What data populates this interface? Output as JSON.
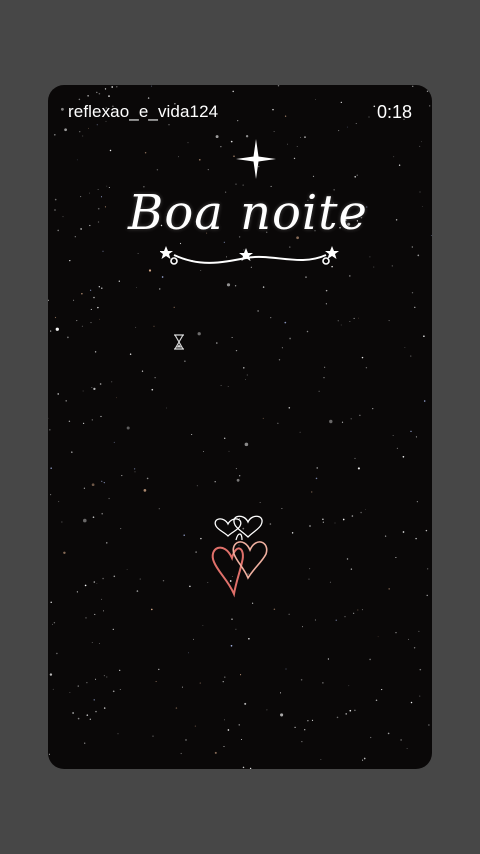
{
  "header": {
    "username": "reflexao_e_vida124",
    "time": "0:18"
  },
  "main": {
    "title": "Boa noite"
  },
  "icons": {
    "sparkle": "sparkle-star-icon",
    "flourish": "stars-flourish-icon",
    "hourglass": "hourglass-icon",
    "hearts": "hearts-icon"
  },
  "colors": {
    "background": "#474747",
    "card": "#0a0808",
    "text": "#ffffff",
    "heart_red": "#e0706a"
  }
}
